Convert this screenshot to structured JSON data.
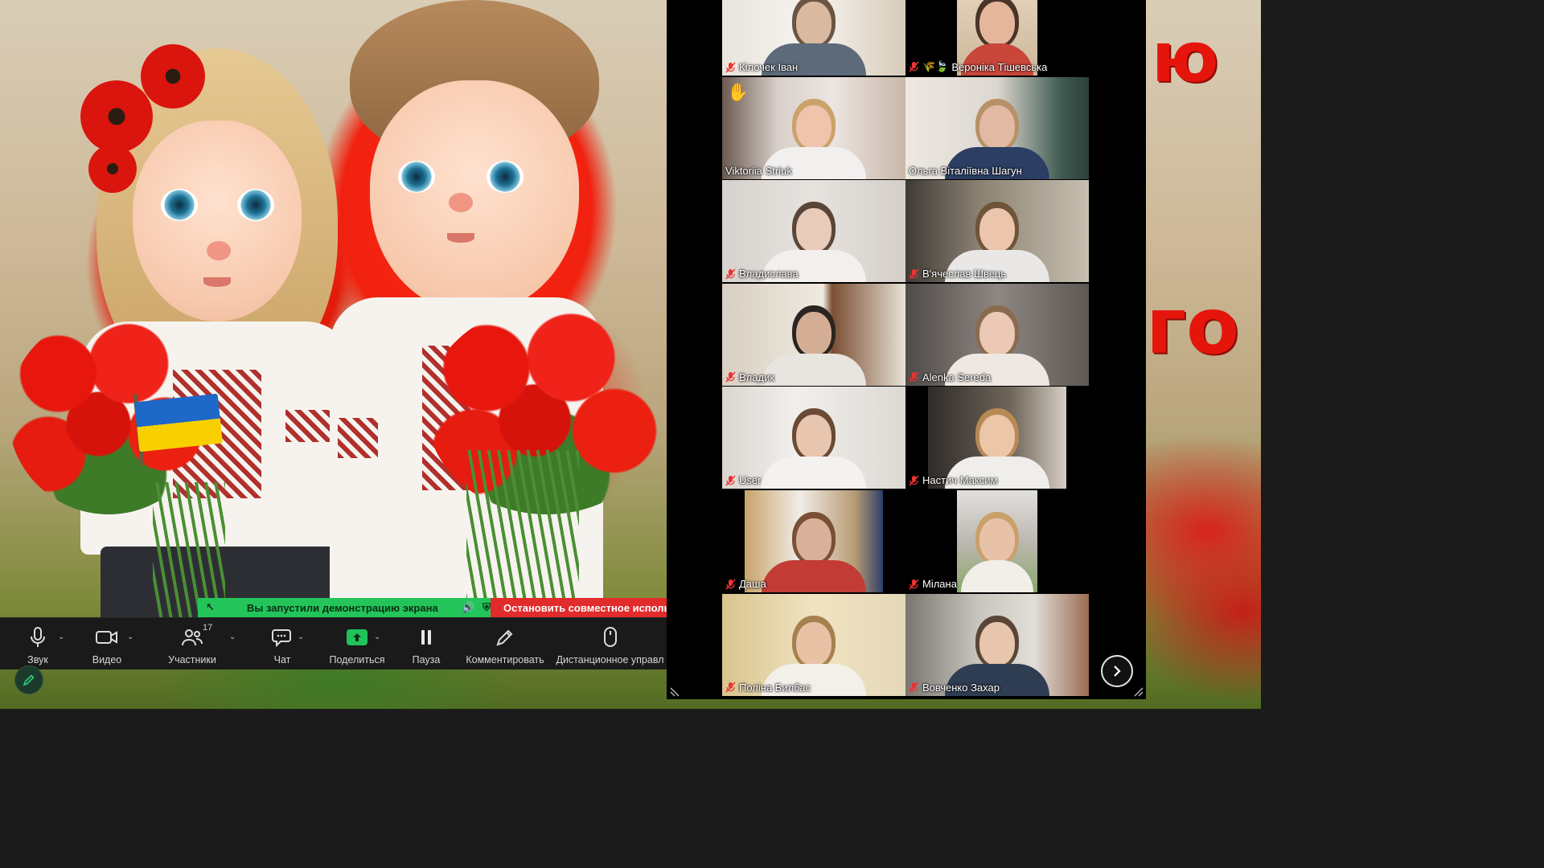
{
  "slide": {
    "right_text_top": "ю",
    "right_text_mid": "го"
  },
  "share_bar": {
    "running_message": "Вы запустили демонстрацию экрана",
    "stop_label": "Остановить совместное использо"
  },
  "toolbar": {
    "audio_label": "Звук",
    "video_label": "Видео",
    "participants_label": "Участники",
    "participants_count": "17",
    "chat_label": "Чат",
    "share_label": "Поделиться",
    "pause_label": "Пауза",
    "annotate_label": "Комментировать",
    "remote_label": "Дистанционное управл"
  },
  "gallery": {
    "tiles": [
      {
        "name": "Кілочек Іван",
        "muted": true
      },
      {
        "name": "Вероніка Тішевська",
        "muted": true,
        "decor": "🌾🍃"
      },
      {
        "name": "Viktoriia Striuk",
        "muted": false,
        "raised_hand": "✋"
      },
      {
        "name": "Ольга Віталіївна Шагун",
        "muted": false
      },
      {
        "name": "Владислава",
        "muted": true
      },
      {
        "name": "В'ячеслав Швець",
        "muted": true
      },
      {
        "name": "Владик",
        "muted": true
      },
      {
        "name": "Alenka Sereda",
        "muted": true
      },
      {
        "name": "User",
        "muted": true,
        "active_speaker": true
      },
      {
        "name": "Настич Максим",
        "muted": true
      },
      {
        "name": "Даша",
        "muted": true
      },
      {
        "name": "Мілана",
        "muted": true
      },
      {
        "name": "Поліна Билбас",
        "muted": true
      },
      {
        "name": "Вовченко Захар",
        "muted": true
      }
    ]
  },
  "colors": {
    "share_green": "#23c55b",
    "stop_red": "#e22b2b",
    "toolbar_bg": "#1a1a1a",
    "active_speaker": "#24d36b"
  }
}
